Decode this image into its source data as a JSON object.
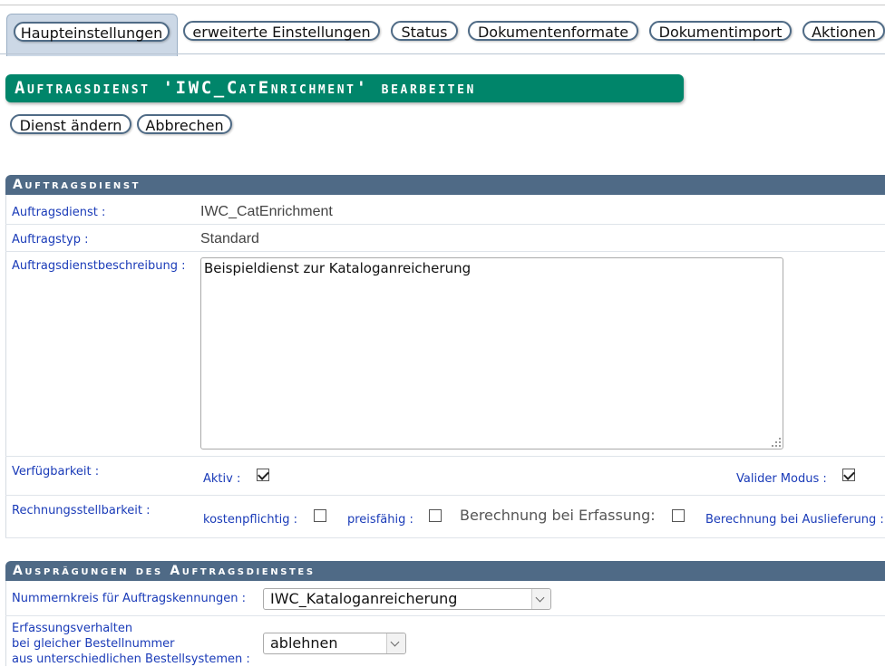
{
  "tabs": [
    {
      "label": "Haupteinstellungen",
      "active": true
    },
    {
      "label": "erweiterte Einstellungen",
      "active": false
    },
    {
      "label": "Status",
      "active": false
    },
    {
      "label": "Dokumentenformate",
      "active": false
    },
    {
      "label": "Dokumentimport",
      "active": false
    },
    {
      "label": "Aktionen",
      "active": false
    }
  ],
  "title": "Auftragsdienst 'IWC_CatEnrichment' bearbeiten",
  "actions": {
    "change": "Dienst ändern",
    "cancel": "Abbrechen"
  },
  "section1": {
    "title": "Auftragsdienst",
    "rows": {
      "dienst": {
        "label": "Auftragsdienst",
        "value": "IWC_CatEnrichment"
      },
      "typ": {
        "label": "Auftragstyp",
        "value": "Standard"
      },
      "beschreibung": {
        "label": "Auftragsdienstbeschreibung",
        "value": "Beispieldienst zur Kataloganreicherung"
      },
      "verfuegbarkeit": {
        "label": "Verfügbarkeit",
        "aktiv_label": "Aktiv",
        "aktiv_checked": true,
        "valider_label": "Valider Modus",
        "valider_checked": true
      },
      "rechnung": {
        "label": "Rechnungsstellbarkeit",
        "kosten_label": "kostenpflichtig",
        "kosten_checked": false,
        "preis_label": "preisfähig",
        "preis_checked": false,
        "erfassung_label": "Berechnung bei Erfassung:",
        "erfassung_checked": false,
        "auslieferung_label": "Berechnung bei Auslieferung"
      }
    }
  },
  "section2": {
    "title": "Ausprägungen des Auftragsdienstes",
    "nummernkreis": {
      "label": "Nummernkreis für Auftragskennungen",
      "value": "IWC_Kataloganreicherung"
    },
    "erfassung": {
      "label_lines": [
        "Erfassungsverhalten",
        "bei gleicher Bestellnummer",
        "aus unterschiedlichen Bestellsystemen"
      ],
      "value": "ablehnen"
    }
  },
  "colon": ":"
}
